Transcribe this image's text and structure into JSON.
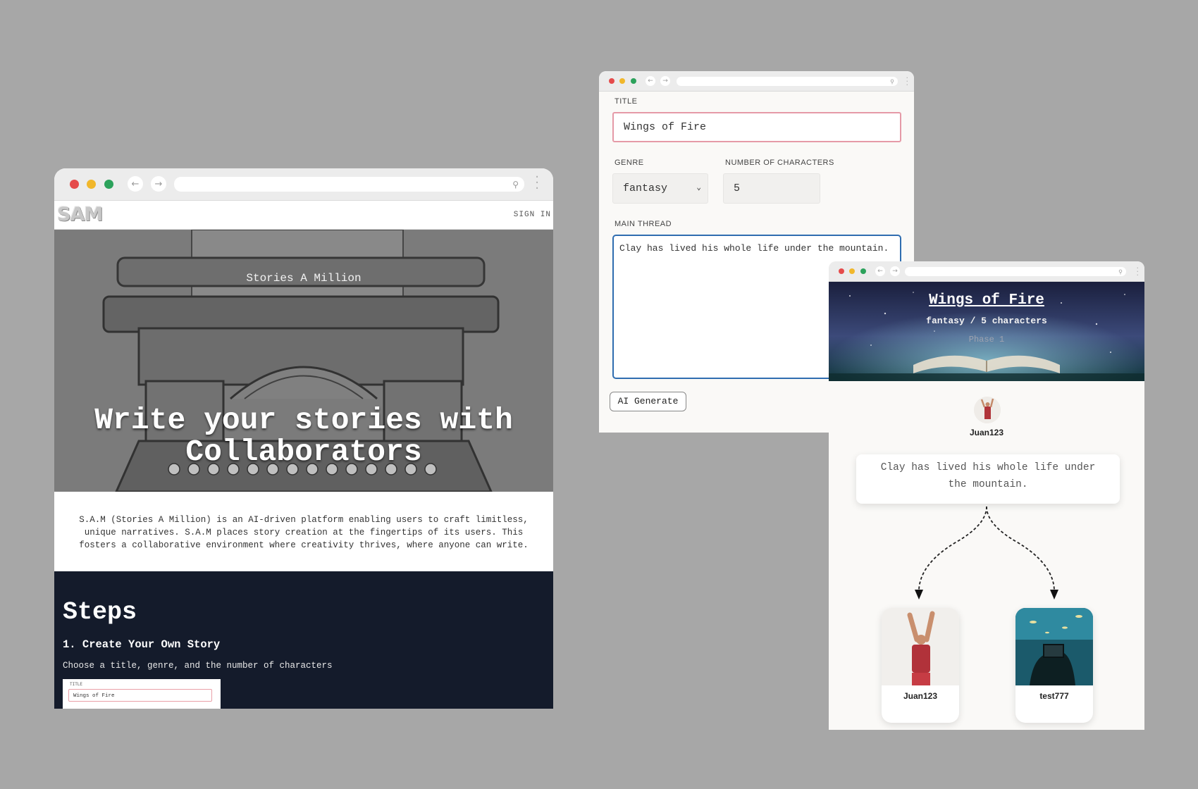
{
  "landing": {
    "logo": "SAM",
    "nav": {
      "sign_in": "SIGN IN"
    },
    "hero": {
      "subtitle": "Stories A Million",
      "headline_line1": "Write your stories with",
      "headline_line2": "Collaborators"
    },
    "about": "S.A.M (Stories A Million) is an AI-driven platform enabling users to craft limitless, unique narratives. S.A.M places story creation at the fingertips of its users. This fosters a collaborative environment where creativity thrives, where anyone can write.",
    "steps": {
      "heading": "Steps",
      "step1_title": "1. Create Your Own Story",
      "step1_desc": "Choose a title, genre, and the number of characters",
      "preview_label": "TITLE",
      "preview_value": "Wings of Fire"
    }
  },
  "create_form": {
    "title_label": "TITLE",
    "title_value": "Wings of Fire",
    "genre_label": "GENRE",
    "genre_value": "fantasy",
    "characters_label": "NUMBER OF CHARACTERS",
    "characters_value": "5",
    "thread_label": "MAIN THREAD",
    "thread_value": "Clay has lived his whole life under the mountain.",
    "generate_button": "AI Generate"
  },
  "story_view": {
    "title": "Wings of Fire",
    "meta": "fantasy / 5 characters",
    "phase": "Phase 1",
    "author": "Juan123",
    "thread_text": "Clay has lived his whole life under the mountain.",
    "branches": [
      {
        "name": "Juan123"
      },
      {
        "name": "test777"
      }
    ]
  },
  "colors": {
    "background": "#a7a7a7",
    "dark_section": "#141b2b",
    "title_input_border": "#e59aa7",
    "thread_border": "#2f6db0",
    "traffic_red": "#e54b4b",
    "traffic_yellow": "#f1b72b",
    "traffic_green": "#2ca25b"
  },
  "icons": {
    "back": "left-arrow-icon",
    "forward": "right-arrow-icon",
    "search": "magnifier-icon",
    "menu": "kebab-menu-icon",
    "select": "chevron-down-icon"
  }
}
